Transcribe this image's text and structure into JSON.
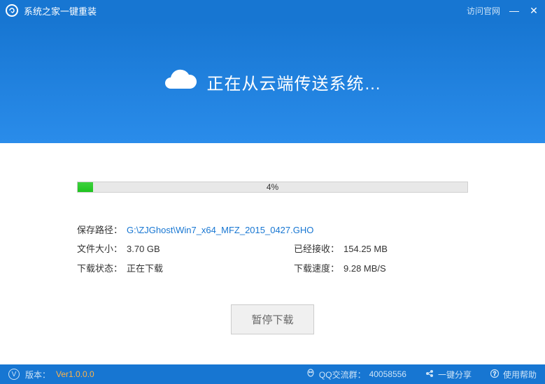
{
  "titlebar": {
    "app_title": "系统之家一键重装",
    "official_link": "访问官网"
  },
  "hero": {
    "status_text": "正在从云端传送系统…"
  },
  "progress": {
    "percent": 4,
    "label": "4%"
  },
  "info": {
    "save_path_label": "保存路径：",
    "save_path_value": "G:\\ZJGhost\\Win7_x64_MFZ_2015_0427.GHO",
    "file_size_label": "文件大小：",
    "file_size_value": "3.70 GB",
    "received_label": "已经接收：",
    "received_value": "154.25 MB",
    "status_label": "下载状态：",
    "status_value": "正在下载",
    "speed_label": "下载速度：",
    "speed_value": "9.28 MB/S"
  },
  "actions": {
    "pause_label": "暂停下载"
  },
  "statusbar": {
    "version_label": "版本：",
    "version_value": "Ver1.0.0.0",
    "qq_label": "QQ交流群：",
    "qq_value": "40058556",
    "share_label": "一键分享",
    "help_label": "使用帮助"
  }
}
